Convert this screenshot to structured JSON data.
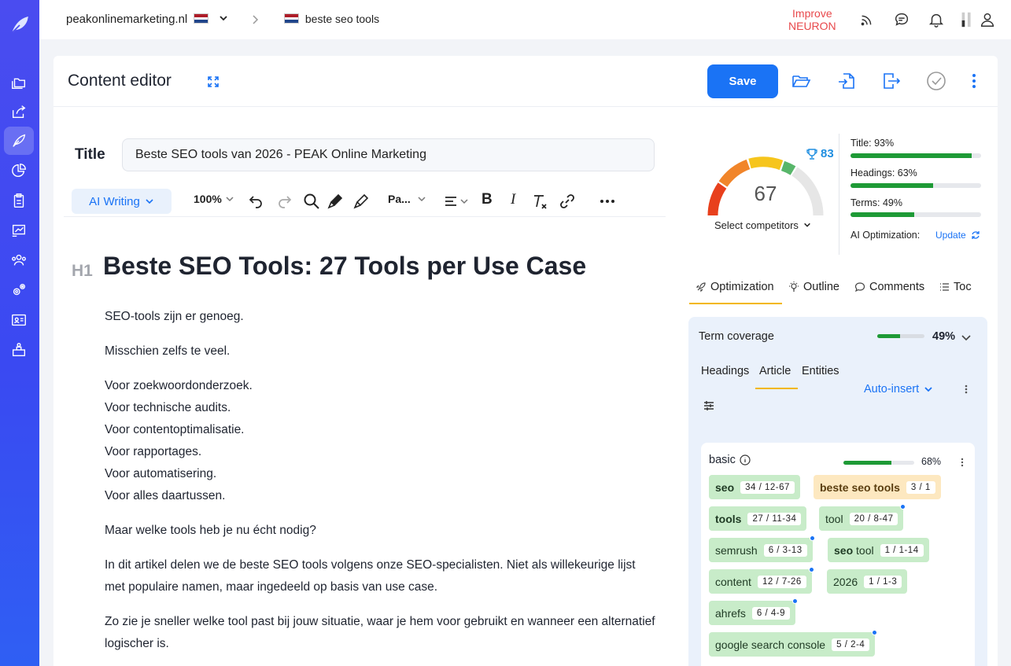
{
  "topbar": {
    "domain": "peakonlinemarketing.nl",
    "crumb": "beste seo tools",
    "improve_line1": "Improve",
    "improve_line2": "NEURON"
  },
  "header": {
    "title": "Content editor",
    "save_label": "Save"
  },
  "editor": {
    "title_label": "Title",
    "title_value": "Beste SEO tools van 2026 - PEAK Online Marketing",
    "ai_writing_label": "AI Writing",
    "zoom": "100%",
    "paragraph_style": "Pa...",
    "h1_tag": "H1",
    "h1": "Beste SEO Tools: 27 Tools per Use Case",
    "p1": "SEO-tools zijn er genoeg.",
    "p2": "Misschien zelfs te veel.",
    "list_lines": [
      "Voor zoekwoordonderzoek.",
      "Voor technische audits.",
      "Voor contentoptimalisatie.",
      "Voor rapportages.",
      "Voor automatisering.",
      "Voor alles daartussen."
    ],
    "p3": "Maar welke tools heb je nu écht nodig?",
    "p4": "In dit artikel delen we de beste SEO tools volgens onze SEO-specialisten. Niet als willekeurige lijst met populaire namen, maar ingedeeld op basis van use case.",
    "p5": "Zo zie je sneller welke tool past bij jouw situatie, waar je hem voor gebruikt en wanneer een alternatief logischer is."
  },
  "score": {
    "value": "67",
    "target": "83",
    "select_competitors": "Select competitors",
    "title_metric": "Title: 93%",
    "title_pct": 93,
    "headings_metric": "Headings: 63%",
    "headings_pct": 63,
    "terms_metric": "Terms: 49%",
    "terms_pct": 49,
    "ai_label": "AI Optimization:",
    "update_label": "Update"
  },
  "tabs": [
    "Optimization",
    "Outline",
    "Comments",
    "Toc"
  ],
  "coverage": {
    "title": "Term coverage",
    "pct_label": "49%",
    "pct": 49,
    "subtabs": [
      "Headings",
      "Article",
      "Entities"
    ],
    "auto_insert": "Auto-insert"
  },
  "basic": {
    "title": "basic",
    "pct_label": "68%",
    "pct": 68,
    "terms": [
      {
        "term": "seo",
        "count": "34 / 12-67"
      },
      {
        "term": "beste seo tools",
        "count": "3 / 1"
      },
      {
        "term": "tools",
        "count": "27 / 11-34"
      },
      {
        "term": "tool",
        "count": "20 / 8-47"
      },
      {
        "term": "semrush",
        "count": "6 / 3-13"
      },
      {
        "term_bold": "seo",
        "term_rest": " tool",
        "count": "1 / 1-14"
      },
      {
        "term": "content",
        "count": "12 / 7-26"
      },
      {
        "term": "2026",
        "count": "1 / 1-3"
      },
      {
        "term": "ahrefs",
        "count": "6 / 4-9"
      },
      {
        "term": "google search console",
        "count": "5 / 2-4"
      }
    ]
  },
  "colors": {
    "sidebar": "#3a49f2",
    "accent": "#1a73f5",
    "green": "#1e9a36",
    "chip_green": "#c8ecc9",
    "chip_orange": "#fde8c0",
    "tab_underline": "#f2b705"
  }
}
